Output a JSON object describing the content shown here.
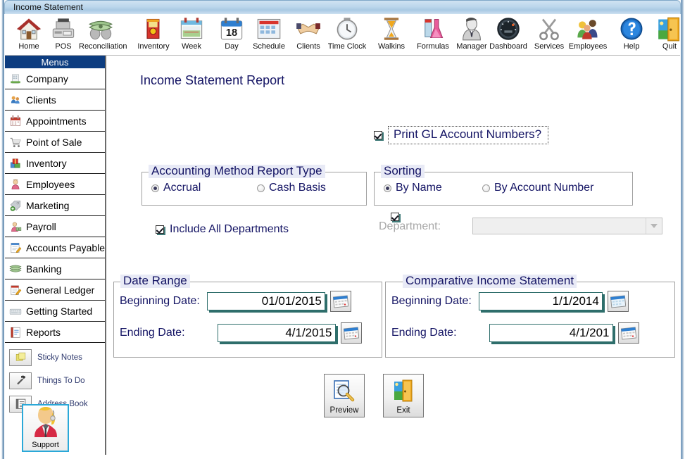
{
  "window": {
    "title": "Income Statement"
  },
  "toolbar": {
    "items": [
      {
        "label": "Home",
        "icon": "house-icon"
      },
      {
        "label": "POS",
        "icon": "cash-register-icon"
      },
      {
        "label": "Reconciliation",
        "icon": "money-bills-icon"
      },
      {
        "label": "Inventory",
        "icon": "product-box-icon"
      },
      {
        "label": "Week",
        "icon": "calendar-week-icon"
      },
      {
        "label": "Day",
        "icon": "calendar-day-18-icon"
      },
      {
        "label": "Schedule",
        "icon": "schedule-grid-icon"
      },
      {
        "label": "Clients",
        "icon": "handshake-icon"
      },
      {
        "label": "Time Clock",
        "icon": "clock-icon"
      },
      {
        "label": "Walkins",
        "icon": "hourglass-icon"
      },
      {
        "label": "Formulas",
        "icon": "flask-icon"
      },
      {
        "label": "Manager",
        "icon": "businessman-icon"
      },
      {
        "label": "Dashboard",
        "icon": "gauge-icon"
      },
      {
        "label": "Services",
        "icon": "scissors-icon"
      },
      {
        "label": "Employees",
        "icon": "people-group-icon"
      },
      {
        "label": "Help",
        "icon": "question-circle-icon"
      },
      {
        "label": "Quit",
        "icon": "exit-door-icon"
      }
    ]
  },
  "sidebar": {
    "header": "Menus",
    "items": [
      {
        "label": "Company",
        "icon": "building-icon"
      },
      {
        "label": "Clients",
        "icon": "clients-icon"
      },
      {
        "label": "Appointments",
        "icon": "calendar-icon"
      },
      {
        "label": "Point of Sale",
        "icon": "shopping-cart-icon"
      },
      {
        "label": "Inventory",
        "icon": "boxes-icon"
      },
      {
        "label": "Employees",
        "icon": "person-icon"
      },
      {
        "label": "Marketing",
        "icon": "tag-plus-icon"
      },
      {
        "label": "Payroll",
        "icon": "person-money-icon"
      },
      {
        "label": "Accounts Payable",
        "icon": "invoice-pen-icon"
      },
      {
        "label": "Banking",
        "icon": "money-icon"
      },
      {
        "label": "General Ledger",
        "icon": "ledger-pen-icon"
      },
      {
        "label": "Getting Started",
        "icon": "keyboard-icon"
      },
      {
        "label": "Reports",
        "icon": "report-book-icon"
      }
    ],
    "tools": [
      {
        "label": "Sticky Notes",
        "icon": "sticky-notes-icon"
      },
      {
        "label": "Things To Do",
        "icon": "hammer-icon"
      },
      {
        "label": "Address Book",
        "icon": "address-book-icon"
      }
    ],
    "support": {
      "label": "Support",
      "icon": "support-agent-icon"
    }
  },
  "form": {
    "title": "Income Statement  Report",
    "print_gl": {
      "label": "Print GL Account Numbers?",
      "checked": true
    },
    "accounting_method": {
      "legend": "Accounting Method Report Type",
      "options": [
        {
          "label": "Accrual",
          "selected": true
        },
        {
          "label": "Cash Basis",
          "selected": false
        }
      ]
    },
    "sorting": {
      "legend": "Sorting",
      "options": [
        {
          "label": "By Name",
          "selected": true
        },
        {
          "label": "By Account Number",
          "selected": false
        }
      ]
    },
    "include_all_departments": {
      "label": "Include All Departments",
      "checked": true
    },
    "department": {
      "label": "Department:",
      "value": "",
      "enabled": false
    },
    "date_range": {
      "legend": "Date Range",
      "beginning_label": "Beginning Date:",
      "beginning_value": "01/01/2015",
      "ending_label": "Ending Date:",
      "ending_value": "4/1/2015",
      "calendar_icon": "calendar-picker-icon"
    },
    "comparative": {
      "legend": "Comparative Income Statement",
      "checked": true,
      "beginning_label": "Beginning Date:",
      "beginning_value": "1/1/2014",
      "ending_label": "Ending Date:",
      "ending_value": "4/1/201",
      "calendar_icon": "calendar-picker-icon"
    },
    "actions": [
      {
        "label": "Preview",
        "icon": "preview-magnifier-icon"
      },
      {
        "label": "Exit",
        "icon": "exit-door-icon"
      }
    ]
  },
  "colors": {
    "menu_header_blue": "#0d3d80",
    "form_text_navy": "#141464",
    "field_border_teal": "#2e6e6b",
    "legend_highlight": "#e8eaf6",
    "support_border": "#2aa8d8"
  }
}
